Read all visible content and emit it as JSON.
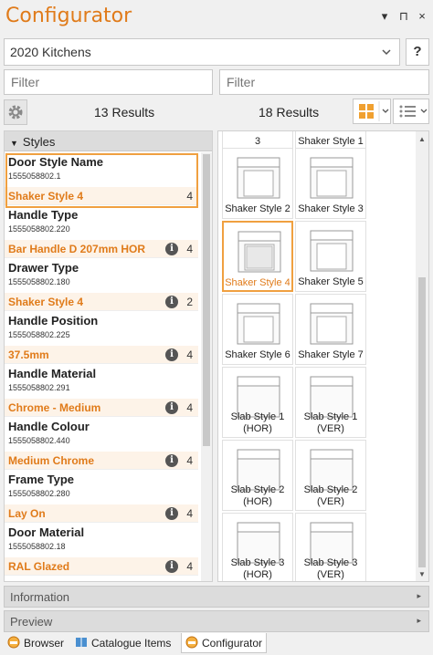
{
  "window": {
    "title": "Configurator",
    "menu_glyph": "▾",
    "pin_glyph": "⊓",
    "close_glyph": "×"
  },
  "catalog": {
    "selected": "2020 Kitchens",
    "help_label": "?"
  },
  "filters": {
    "left_placeholder": "Filter",
    "right_placeholder": "Filter"
  },
  "results": {
    "left_count": "13 Results",
    "right_count": "18 Results"
  },
  "styles_panel": {
    "header": "Styles",
    "properties": [
      {
        "name": "Door Style Name",
        "code": "1555058802.1",
        "value": "Shaker Style 4",
        "count": "4",
        "info": false
      },
      {
        "name": "Handle Type",
        "code": "1555058802.220",
        "value": "Bar Handle D 207mm HOR",
        "count": "4",
        "info": true
      },
      {
        "name": "Drawer Type",
        "code": "1555058802.180",
        "value": "Shaker Style 4",
        "count": "2",
        "info": true
      },
      {
        "name": "Handle Position",
        "code": "1555058802.225",
        "value": "37.5mm",
        "count": "4",
        "info": true
      },
      {
        "name": "Handle Material",
        "code": "1555058802.291",
        "value": "Chrome - Medium",
        "count": "4",
        "info": true
      },
      {
        "name": "Handle Colour",
        "code": "1555058802.440",
        "value": "Medium Chrome",
        "count": "4",
        "info": true
      },
      {
        "name": "Frame Type",
        "code": "1555058802.280",
        "value": "Lay On",
        "count": "4",
        "info": true
      },
      {
        "name": "Door Material",
        "code": "1555058802.18",
        "value": "RAL Glazed",
        "count": "4",
        "info": true
      }
    ],
    "info_glyph": "i"
  },
  "tiles": [
    {
      "label": "3",
      "partial": true
    },
    {
      "label": "Shaker Style 1",
      "partial": true
    },
    {
      "label": "Shaker Style 2"
    },
    {
      "label": "Shaker Style 3"
    },
    {
      "label": "Shaker Style 4",
      "selected": true
    },
    {
      "label": "Shaker Style 5"
    },
    {
      "label": "Shaker Style 6"
    },
    {
      "label": "Shaker Style 7"
    },
    {
      "label": "Slab Style 1 (HOR)"
    },
    {
      "label": "Slab Style 1 (VER)"
    },
    {
      "label": "Slab Style 2 (HOR)"
    },
    {
      "label": "Slab Style 2 (VER)"
    },
    {
      "label": "Slab Style 3 (HOR)"
    },
    {
      "label": "Slab Style 3 (VER)"
    }
  ],
  "sections": {
    "information": "Information",
    "preview": "Preview",
    "arrow": "▸"
  },
  "bottom_tabs": [
    {
      "label": "Browser",
      "icon": "browser-icon"
    },
    {
      "label": "Catalogue Items",
      "icon": "book-icon"
    },
    {
      "label": "Configurator",
      "icon": "configurator-icon",
      "active": true
    }
  ],
  "colors": {
    "accent": "#e07b1a",
    "selection": "#f0a040",
    "value_bg": "#fdf3e8",
    "grid_orange": "#f0a030"
  }
}
